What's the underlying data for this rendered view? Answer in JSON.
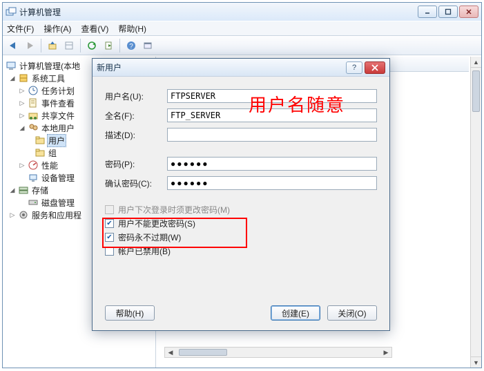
{
  "window": {
    "title": "计算机管理",
    "menus": {
      "file": "文件(F)",
      "action": "操作(A)",
      "view": "查看(V)",
      "help": "帮助(H)"
    }
  },
  "tree": {
    "root": "计算机管理(本地",
    "system_tools": "系统工具",
    "task_sched": "任务计划",
    "event_viewer": "事件查看",
    "shared_folders": "共享文件",
    "local_users": "本地用户",
    "users_folder": "用户",
    "groups_folder": "组",
    "performance": "性能",
    "device_mgr": "设备管理",
    "storage": "存储",
    "disk_mgmt": "磁盘管理",
    "services_apps": "服务和应用程"
  },
  "right_column_header": "",
  "dialog": {
    "title": "新用户",
    "labels": {
      "username": "用户名(U):",
      "fullname": "全名(F):",
      "description": "描述(D):",
      "password": "密码(P):",
      "confirm": "确认密码(C):"
    },
    "values": {
      "username": "FTPSERVER",
      "fullname": "FTP_SERVER",
      "description": "",
      "password": "●●●●●●",
      "confirm": "●●●●●●"
    },
    "checks": {
      "must_change": "用户下次登录时须更改密码(M)",
      "cannot_change": "用户不能更改密码(S)",
      "never_expire": "密码永不过期(W)",
      "disabled": "帐户已禁用(B)"
    },
    "buttons": {
      "help": "帮助(H)",
      "create": "创建(E)",
      "close": "关闭(O)"
    }
  },
  "annotation": {
    "text": "用户名随意"
  }
}
